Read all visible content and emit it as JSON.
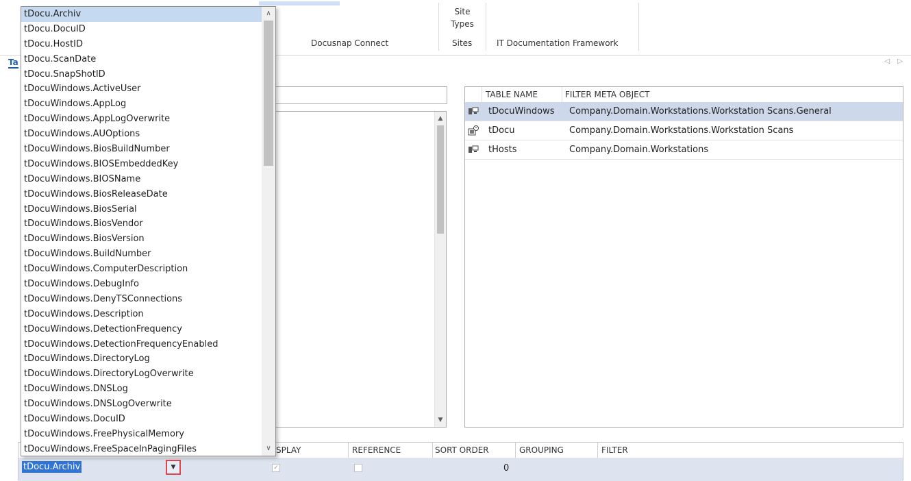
{
  "ribbon": {
    "docusnap_connect": "Docusnap Connect",
    "site_types_line1": "Site",
    "site_types_line2": "Types",
    "sites": "Sites",
    "it_doc_framework": "IT Documentation Framework"
  },
  "tab_partial": "Ta",
  "nav_arrows": "◁ ▷",
  "tables_panel": {
    "headers": [
      "TABLE NAME",
      "FILTER META OBJECT"
    ],
    "rows": [
      {
        "table": "tDocuWindows",
        "filter": "Company.Domain.Workstations.Workstation Scans.General",
        "icon": "workstation-icon"
      },
      {
        "table": "tDocu",
        "filter": "Company.Domain.Workstations.Workstation Scans",
        "icon": "scan-history-icon"
      },
      {
        "table": "tHosts",
        "filter": "Company.Domain.Workstations",
        "icon": "workstation-icon"
      }
    ]
  },
  "grid": {
    "headers": [
      "DISPLAY",
      "REFERENCE",
      "SORT ORDER",
      "GROUPING",
      "FILTER"
    ],
    "display_header_partial": "SPLAY",
    "row": {
      "field": "tDocu.Archiv",
      "sort_order": "0",
      "display_checked": true,
      "reference_checked": false
    }
  },
  "dropdown": {
    "selected": "tDocu.Archiv",
    "items": [
      "tDocu.Archiv",
      "tDocu.DocuID",
      "tDocu.HostID",
      "tDocu.ScanDate",
      "tDocu.SnapShotID",
      "tDocuWindows.ActiveUser",
      "tDocuWindows.AppLog",
      "tDocuWindows.AppLogOverwrite",
      "tDocuWindows.AUOptions",
      "tDocuWindows.BiosBuildNumber",
      "tDocuWindows.BIOSEmbeddedKey",
      "tDocuWindows.BIOSName",
      "tDocuWindows.BiosReleaseDate",
      "tDocuWindows.BiosSerial",
      "tDocuWindows.BiosVendor",
      "tDocuWindows.BiosVersion",
      "tDocuWindows.BuildNumber",
      "tDocuWindows.ComputerDescription",
      "tDocuWindows.DebugInfo",
      "tDocuWindows.DenyTSConnections",
      "tDocuWindows.Description",
      "tDocuWindows.DetectionFrequency",
      "tDocuWindows.DetectionFrequencyEnabled",
      "tDocuWindows.DirectoryLog",
      "tDocuWindows.DirectoryLogOverwrite",
      "tDocuWindows.DNSLog",
      "tDocuWindows.DNSLogOverwrite",
      "tDocuWindows.DocuID",
      "tDocuWindows.FreePhysicalMemory",
      "tDocuWindows.FreeSpaceInPagingFiles"
    ]
  },
  "colors": {
    "selection": "#cdd9ea",
    "highlight_value": "#3074d6",
    "dropdown_button_outline": "#e3454f",
    "dropdown_active": "#c5d9f1"
  }
}
